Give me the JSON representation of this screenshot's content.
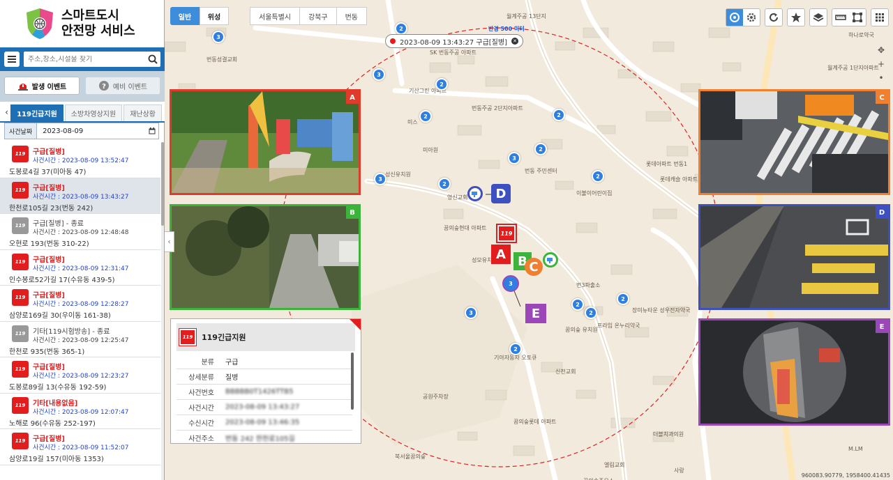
{
  "brand": {
    "line1": "스마트도시",
    "line2": "안전망 서비스"
  },
  "search": {
    "placeholder": "주소,장소,시설물 찾기"
  },
  "event_buttons": {
    "active": "발생 이벤트",
    "inactive": "예비 이벤트"
  },
  "tabs": [
    "119긴급지원",
    "소방차영상지원",
    "재난상황"
  ],
  "date_filter": {
    "label": "사건날짜",
    "value": "2023-08-09"
  },
  "events": [
    {
      "title": "구급[질병]",
      "time": "사건시간 : 2023-08-09 13:52:47",
      "addr": "도봉로4길 37(미아동 47)",
      "style": "red"
    },
    {
      "title": "구급[질병]",
      "time": "사건시간 : 2023-08-09 13:43:27",
      "addr": "한천로105길 23(번동 242)",
      "style": "red"
    },
    {
      "title": "구급[질병] - 종료",
      "time": "사건시간 : 2023-08-09 12:48:48",
      "addr": "오현로 193(번동 310-22)",
      "style": "gray"
    },
    {
      "title": "구급[질병]",
      "time": "사건시간 : 2023-08-09 12:31:47",
      "addr": "인수봉로52가길 17(수유동 439-5)",
      "style": "red"
    },
    {
      "title": "구급[질병]",
      "time": "사건시간 : 2023-08-09 12:28:27",
      "addr": "삼양로169길 30(우이동 161-38)",
      "style": "red"
    },
    {
      "title": "기타[119시험방송] - 종료",
      "time": "사건시간 : 2023-08-09 12:25:47",
      "addr": "한천로 935(번동 365-1)",
      "style": "gray"
    },
    {
      "title": "구급[질병]",
      "time": "사건시간 : 2023-08-09 12:23:27",
      "addr": "도봉로89길 13(수유동 192-59)",
      "style": "red"
    },
    {
      "title": "기타[내용없음]",
      "time": "사건시간 : 2023-08-09 12:07:47",
      "addr": "노해로 96(수유동 252-197)",
      "style": "red"
    },
    {
      "title": "구급[질병]",
      "time": "사건시간 : 2023-08-09 11:52:07",
      "addr": "삼양로19길 157(미아동 1353)",
      "style": "red"
    }
  ],
  "map": {
    "view_modes": [
      "일반",
      "위성"
    ],
    "breadcrumb": [
      "서울특별시",
      "강북구",
      "번동"
    ],
    "radius_label": "반경 500 미터",
    "incident": "2023-08-09 13:43:27 구급[질병]",
    "coords": "960083.90779, 1958400.41435",
    "incident_logo": "119",
    "cluster_counts": [
      "3",
      "2",
      "3",
      "2",
      "2",
      "3",
      "2",
      "2",
      "2",
      "2",
      "2",
      "2",
      "3",
      "2",
      "2",
      "3"
    ],
    "place_labels": [
      "번동성결교회",
      "SK 번동주공 아파트",
      "기산그린 아파트",
      "미스",
      "번동주공 2단지아파트",
      "성신유치원",
      "미아원",
      "번동 주민센터",
      "이불이어린이집",
      "영신교회",
      "꿈의숲현대 아파트",
      "성모유치원",
      "번3파출소",
      "장미뉴타운 성우전자약국",
      "프라임 온누리약국",
      "꿈의숲 유치원",
      "기아자동차 오토큐",
      "신천교회",
      "공원주차장",
      "꿈의숲롯데 아파트",
      "북서울꿈의숲",
      "월계주공 1단지아파트",
      "하나로약국",
      "롯데아파트 번동1",
      "롯데캐슬 아파트",
      "더블치과의원",
      "M.LM",
      "엘림교회",
      "사랑",
      "꿈의숲주유소",
      "월계주공 13단지"
    ]
  },
  "cctv_labels": [
    "A",
    "B",
    "C",
    "D",
    "E"
  ],
  "info_panel": {
    "title": "119긴급지원",
    "rows": [
      {
        "k": "분류",
        "v": "구급"
      },
      {
        "k": "상세분류",
        "v": "질병"
      },
      {
        "k": "사건번호",
        "v": "BBBBB0T1426TTB5"
      },
      {
        "k": "사건시간",
        "v": "2023-08-09 13:43:27"
      },
      {
        "k": "수신시간",
        "v": "2023-08-09 13:46:35"
      },
      {
        "k": "사건주소",
        "v": "번동 242 한천로105길"
      }
    ]
  },
  "colors": {
    "accent": "#1f6fb5",
    "alert": "#e11d1d",
    "cam_a": "#e03a2a",
    "cam_b": "#3cb43c",
    "cam_c": "#f08030",
    "cam_d": "#3e4fc0",
    "cam_e": "#9b47b8"
  }
}
